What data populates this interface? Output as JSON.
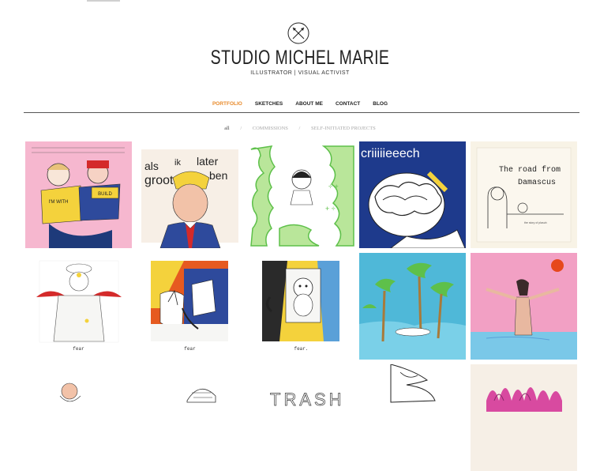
{
  "brand": {
    "name": "STUDIO MICHEL MARIE",
    "tagline_left": "ILLUSTRATOR",
    "tagline_sep": "|",
    "tagline_right": "VISUAL ACTIVIST"
  },
  "nav": {
    "items": [
      {
        "label": "PORTFOLIO",
        "active": true
      },
      {
        "label": "SKETCHES",
        "active": false
      },
      {
        "label": "ABOUT ME",
        "active": false
      },
      {
        "label": "CONTACT",
        "active": false
      },
      {
        "label": "BLOG",
        "active": false
      }
    ]
  },
  "filters": {
    "items": [
      "all",
      "COMMISSIONS",
      "SELF-INITIATED PROJECTS"
    ],
    "separator": "/"
  },
  "tiles": {
    "t1": {
      "text_a": "I'M WITH",
      "text_b": "BUILD"
    },
    "t2": {
      "w1": "als",
      "w2": "ik",
      "w3": "later",
      "w4": "groot",
      "w5": "ben"
    },
    "t4": {
      "text": "criiiiieeech"
    },
    "t5": {
      "line1": "The road from",
      "line2": "Damascus",
      "small": "the story of plasuh"
    },
    "t6": {
      "caption": "fear"
    },
    "t7": {
      "caption": "fear"
    },
    "t8": {
      "caption": "fear."
    },
    "t13": {
      "text": "TRASH"
    }
  },
  "colors": {
    "accent": "#e88a2a",
    "rule": "#555555",
    "pink": "#f2a0c4",
    "green": "#5ec04a",
    "sky": "#4fb8d8",
    "red": "#d42a2a",
    "yellow": "#f4d23c"
  }
}
